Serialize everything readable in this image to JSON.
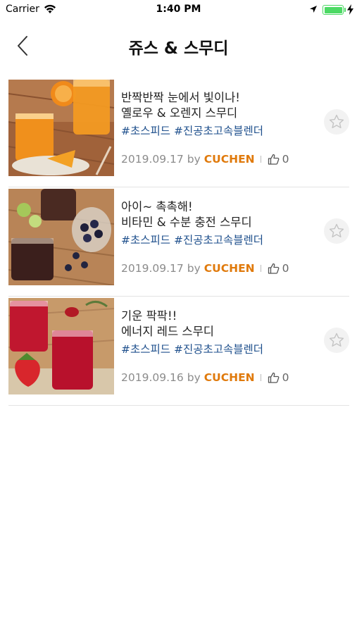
{
  "status_bar": {
    "carrier": "Carrier",
    "time": "1:40 PM"
  },
  "nav": {
    "title": "쥬스 & 스무디"
  },
  "colors": {
    "tag": "#1e4f8c",
    "author": "#e07a0c",
    "battery": "#4cd964",
    "divider": "#e3e3e3"
  },
  "recipes": [
    {
      "title_line1": "반짝반짝 눈에서 빛이나!",
      "title_line2": "옐로우 & 오렌지 스무디",
      "tags": "#초스피드 #진공초고속블렌더",
      "date": "2019.09.17",
      "by": "by",
      "author": "CUCHEN",
      "likes": "0",
      "photo": "orange-smoothie-photo"
    },
    {
      "title_line1": "아이~ 촉촉해!",
      "title_line2": "비타민 & 수분 충전 스무디",
      "tags": "#초스피드 #진공초고속블렌더",
      "date": "2019.09.17",
      "by": "by",
      "author": "CUCHEN",
      "likes": "0",
      "photo": "berry-smoothie-photo"
    },
    {
      "title_line1": "기운 팍팍!!",
      "title_line2": "에너지 레드 스무디",
      "tags": "#초스피드 #진공초고속블렌더",
      "date": "2019.09.16",
      "by": "by",
      "author": "CUCHEN",
      "likes": "0",
      "photo": "red-smoothie-photo"
    }
  ]
}
